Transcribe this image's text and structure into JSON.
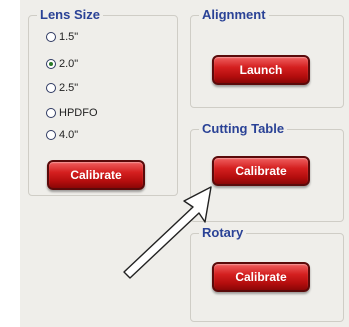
{
  "lens_size": {
    "title": "Lens Size",
    "options": [
      {
        "label": "1.5\"",
        "checked": false
      },
      {
        "label": "2.0\"",
        "checked": true
      },
      {
        "label": "2.5\"",
        "checked": false
      },
      {
        "label": "HPDFO",
        "checked": false
      },
      {
        "label": "4.0\"",
        "checked": false
      }
    ],
    "button_label": "Calibrate"
  },
  "alignment": {
    "title": "Alignment",
    "button_label": "Launch"
  },
  "cutting_table": {
    "title": "Cutting Table",
    "button_label": "Calibrate"
  },
  "rotary": {
    "title": "Rotary",
    "button_label": "Calibrate"
  },
  "colors": {
    "group_title": "#2a4296",
    "button_red": "#c8161a",
    "panel_background": "#efeeea"
  },
  "icons": {
    "pointer": "arrow-pointer-icon"
  }
}
